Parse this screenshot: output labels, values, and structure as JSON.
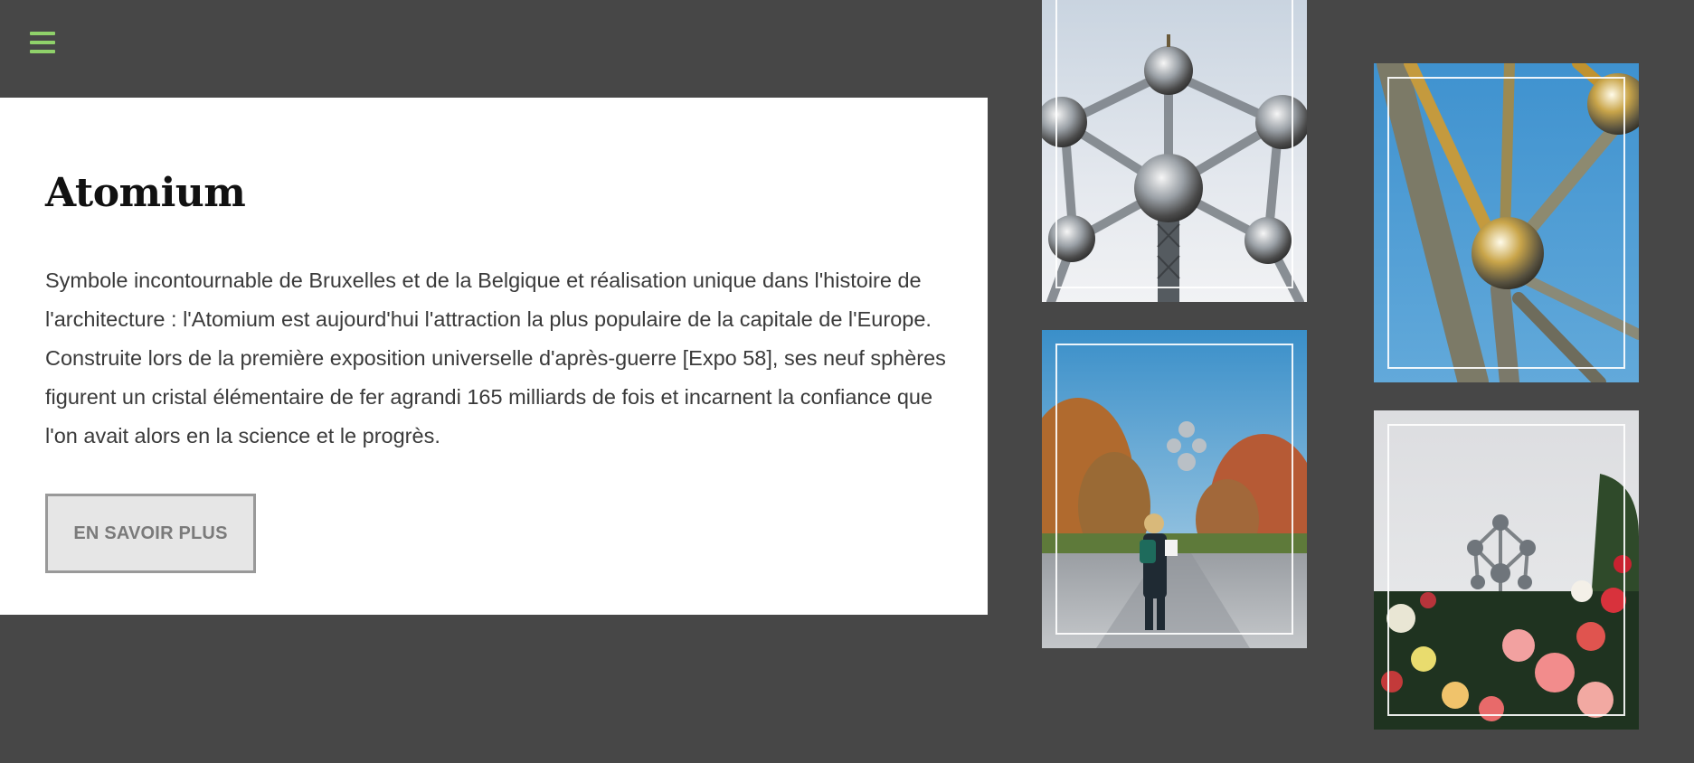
{
  "nav": {
    "menu_icon": "hamburger-menu-icon",
    "accent_color": "#8fd16a"
  },
  "feature": {
    "title": "Atomium",
    "description": "Symbole incontournable de Bruxelles et de la Belgique et réalisation unique dans l'histoire de l'architecture : l'Atomium est aujourd'hui l'attraction la plus populaire de la capitale de l'Europe. Construite lors de la première exposition universelle d'après-guerre [Expo 58], ses neuf sphères figurent un cristal élémentaire de fer agrandi 165 milliards de fois et incarnent la confiance que l'on avait alors en la science et le progrès.",
    "button_label": "EN SAVOIR PLUS"
  },
  "gallery": {
    "photos": [
      "atomium-spheres-photo",
      "atomium-avenue-photo",
      "atomium-detail-photo",
      "atomium-flowers-photo"
    ]
  },
  "colors": {
    "background": "#474747",
    "card": "#ffffff",
    "button_background": "#e6e6e6",
    "button_border": "#999999"
  }
}
